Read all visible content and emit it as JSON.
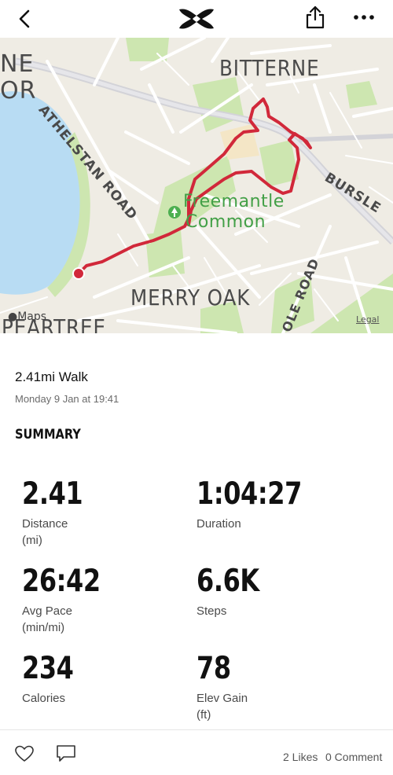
{
  "topbar": {
    "back": "chevron-left-icon",
    "logo": "under-armour-logo",
    "share": "share-icon",
    "more": "more-icon"
  },
  "map": {
    "labels": {
      "bitterne": "BITTERNE",
      "athelstan": "ATHELSTAN ROAD",
      "freemantle": "Freemantle",
      "common": "Common",
      "merry_oak": "MERRY OAK",
      "bursledon": "BURSLE",
      "pole_road": "OLE ROAD",
      "peartree": "PEARTREE",
      "ne": "NE",
      "or": "OR",
      "maps": "Maps",
      "legal": "Legal"
    },
    "colors": {
      "route": "#d1283a",
      "water": "#b8dcf3",
      "park": "#cde6b0",
      "land": "#efece4",
      "road": "#ffffff",
      "highway": "#d3d3d8"
    }
  },
  "activity": {
    "title": "2.41mi Walk",
    "date": "Monday 9 Jan at 19:41"
  },
  "summary": {
    "title": "SUMMARY",
    "stats": [
      {
        "value": "2.41",
        "label": "Distance",
        "unit": "(mi)"
      },
      {
        "value": "1:04:27",
        "label": "Duration",
        "unit": ""
      },
      {
        "value": "26:42",
        "label": "Avg Pace",
        "unit": "(min/mi)"
      },
      {
        "value": "6.6K",
        "label": "Steps",
        "unit": ""
      },
      {
        "value": "234",
        "label": "Calories",
        "unit": ""
      },
      {
        "value": "78",
        "label": "Elev Gain",
        "unit": "(ft)"
      }
    ]
  },
  "social": {
    "likes": "2 Likes",
    "comments": "0 Comment"
  }
}
